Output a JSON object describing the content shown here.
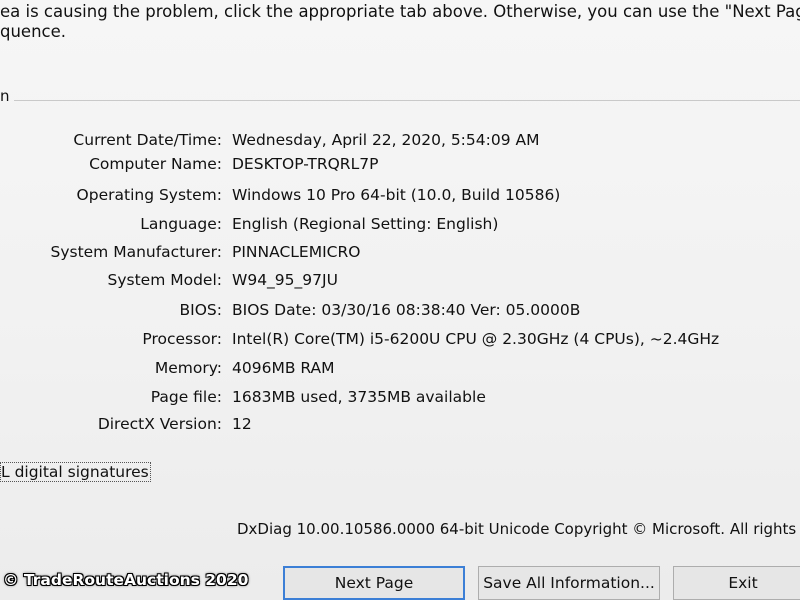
{
  "intro": {
    "line1": "ea is causing the problem, click the appropriate tab above.  Otherwise, you can use the \"Next Page\" button below",
    "line2": "quence."
  },
  "group": {
    "title_fragment": "n"
  },
  "system_info": [
    {
      "label": "Current Date/Time:",
      "value": "Wednesday, April 22, 2020, 5:54:09 AM"
    },
    {
      "label": "Computer Name:",
      "value": "DESKTOP-TRQRL7P"
    },
    {
      "label": "Operating System:",
      "value": "Windows 10 Pro 64-bit (10.0, Build 10586)"
    },
    {
      "label": "Language:",
      "value": "English (Regional Setting: English)"
    },
    {
      "label": "System Manufacturer:",
      "value": "PINNACLEMICRO"
    },
    {
      "label": "System Model:",
      "value": "W94_95_97JU"
    },
    {
      "label": "BIOS:",
      "value": "BIOS Date: 03/30/16 08:38:40 Ver: 05.0000B"
    },
    {
      "label": "Processor:",
      "value": "Intel(R) Core(TM) i5-6200U CPU @ 2.30GHz (4 CPUs), ~2.4GHz"
    },
    {
      "label": "Memory:",
      "value": "4096MB RAM"
    },
    {
      "label": "Page file:",
      "value": "1683MB used, 3735MB available"
    },
    {
      "label": "DirectX Version:",
      "value": "12"
    }
  ],
  "checkbox": {
    "label": "L digital signatures"
  },
  "footer": {
    "copyright": "DxDiag 10.00.10586.0000 64-bit Unicode  Copyright © Microsoft. All rights rese"
  },
  "buttons": {
    "next_page": "Next Page",
    "save_all": "Save All Information...",
    "exit": "Exit"
  },
  "watermark": "© TradeRouteAuctions 2020"
}
